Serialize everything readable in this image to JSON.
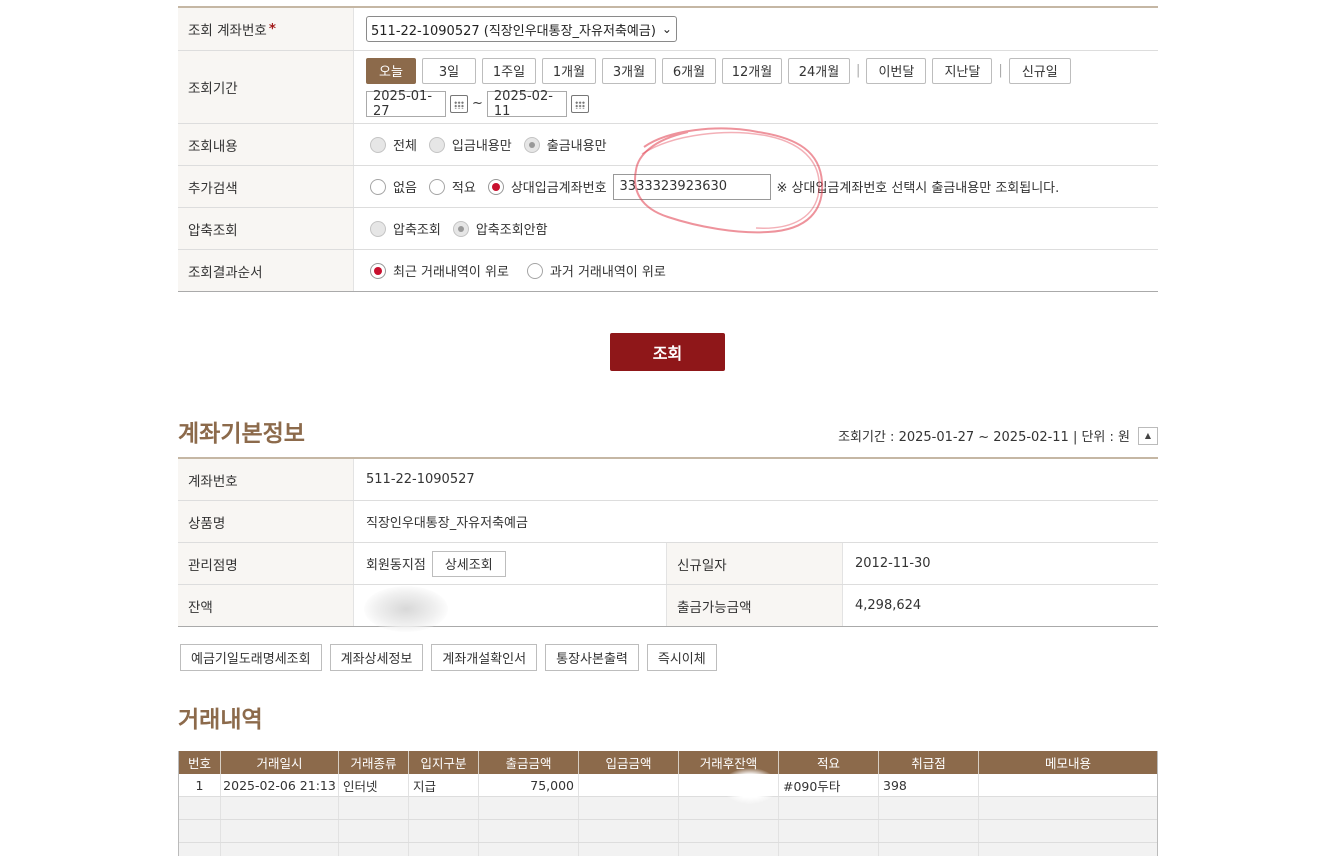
{
  "form": {
    "account_label": "조회 계좌번호",
    "account_required": "*",
    "account_value": "511-22-1090527 (직장인우대통장_자유저축예금)",
    "period_label": "조회기간",
    "period_buttons": [
      "오늘",
      "3일",
      "1주일",
      "1개월",
      "3개월",
      "6개월",
      "12개월",
      "24개월"
    ],
    "period_buttons2": [
      "이번달",
      "지난달"
    ],
    "period_buttons3": [
      "신규일"
    ],
    "date_from": "2025-01-27",
    "date_sep": "~",
    "date_to": "2025-02-11",
    "content_label": "조회내용",
    "content_options": [
      "전체",
      "입금내용만",
      "출금내용만"
    ],
    "extra_label": "추가검색",
    "extra_options": [
      "없음",
      "적요",
      "상대입금계좌번호"
    ],
    "extra_value": "3333323923630",
    "extra_note": "※ 상대입금계좌번호 선택시 출금내용만 조회됩니다.",
    "compress_label": "압축조회",
    "compress_options": [
      "압축조회",
      "압축조회안함"
    ],
    "order_label": "조회결과순서",
    "order_options": [
      "최근 거래내역이 위로",
      "과거 거래내역이 위로"
    ],
    "search_button": "조회"
  },
  "info": {
    "title": "계좌기본정보",
    "period_text": "조회기간 : 2025-01-27 ~ 2025-02-11 | 단위 : 원",
    "account_no_label": "계좌번호",
    "account_no": "511-22-1090527",
    "product_label": "상품명",
    "product": "직장인우대통장_자유저축예금",
    "branch_label": "관리점명",
    "branch": "회원동지점",
    "detail_button": "상세조회",
    "opened_label": "신규일자",
    "opened": "2012-11-30",
    "balance_label": "잔액",
    "available_label": "출금가능금액",
    "available": "4,298,624"
  },
  "actions": [
    "예금기일도래명세조회",
    "계좌상세정보",
    "계좌개설확인서",
    "통장사본출력",
    "즉시이체"
  ],
  "history": {
    "title": "거래내역",
    "columns": [
      "번호",
      "거래일시",
      "거래종류",
      "입지구분",
      "출금금액",
      "입금금액",
      "거래후잔액",
      "적요",
      "취급점",
      "메모내용"
    ],
    "rows": [
      [
        "1",
        "2025-02-06 21:13",
        "인터넷",
        "지급",
        "75,000",
        "",
        "",
        "#090두타",
        "398",
        ""
      ]
    ]
  },
  "colors": {
    "accent": "#8c6a4b",
    "search_button": "#8f1719",
    "radio_selected": "#c8102e"
  }
}
